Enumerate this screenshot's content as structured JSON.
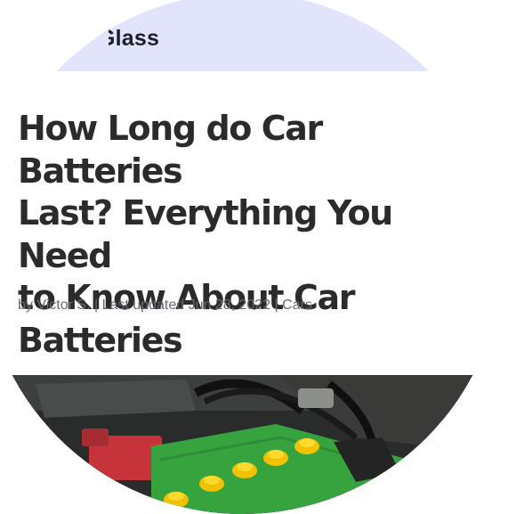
{
  "header": {
    "brand": "Glass"
  },
  "article": {
    "title_lines": [
      "How Long do Car Batteries",
      "Last? Everything You Need",
      "to Know About Car",
      "Batteries"
    ],
    "meta": {
      "by": "by",
      "author": "Victor S.",
      "sep": "|",
      "updated": "Last updated Jun 28, 2022",
      "category": "Cars"
    },
    "hero_image": "car-battery-photo"
  },
  "colors": {
    "nav_band": "#e1e4fb",
    "title": "#2b2b2b",
    "meta": "#666a72",
    "battery_green": "#36a33f",
    "cap_yellow": "#f2c200",
    "terminal_red": "#c6333b"
  }
}
